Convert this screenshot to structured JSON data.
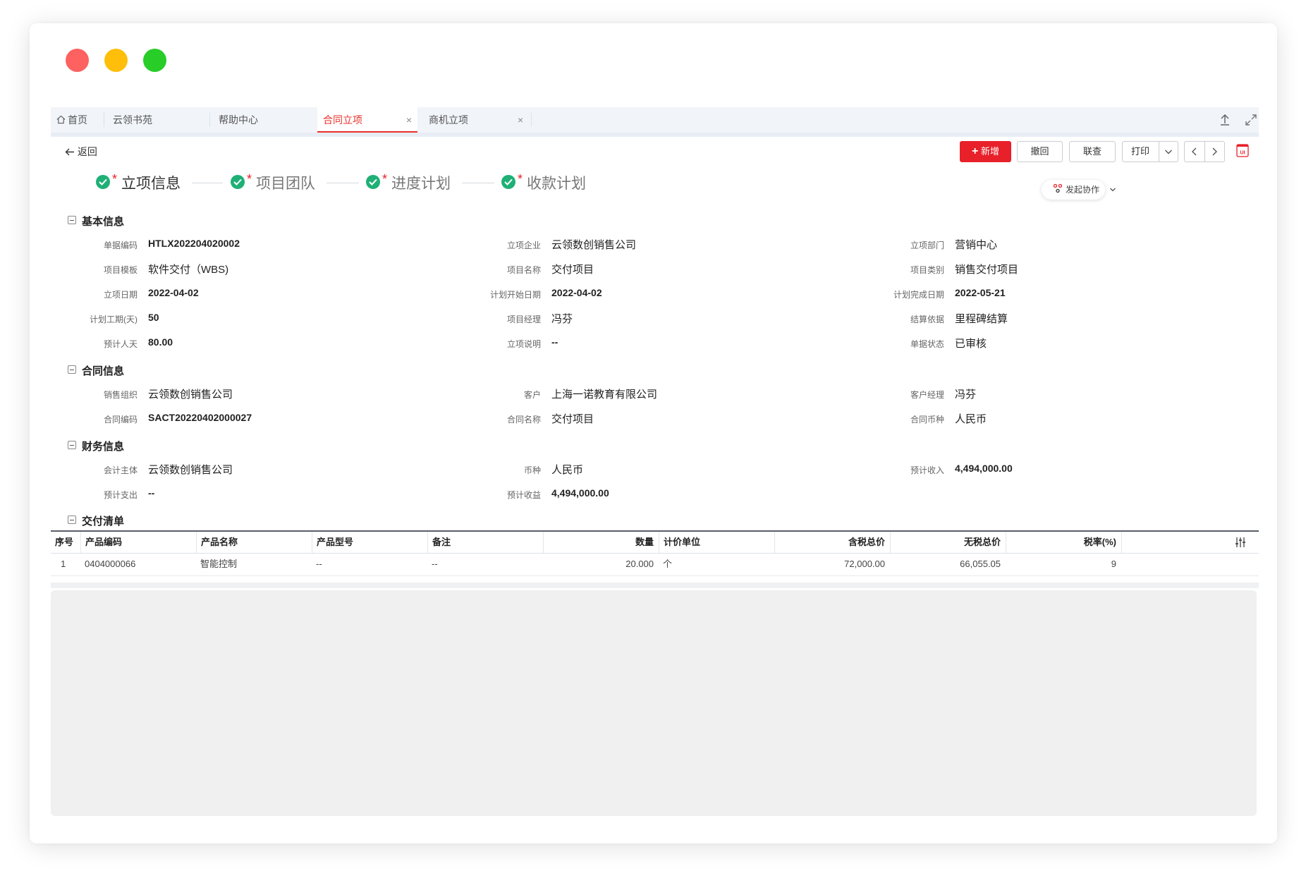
{
  "tabs": [
    {
      "label": "首页",
      "icon": "home-icon"
    },
    {
      "label": "云领书苑"
    },
    {
      "label": "帮助中心"
    },
    {
      "label": "合同立项",
      "active": true,
      "closable": true
    },
    {
      "label": "商机立项",
      "closable": true
    }
  ],
  "tab_close": "×",
  "toolbar": {
    "back": "返回",
    "new_label": "新增",
    "withdraw_label": "撤回",
    "link_query_label": "联查",
    "print_label": "打印"
  },
  "steps": [
    {
      "label": "立项信息"
    },
    {
      "label": "项目团队"
    },
    {
      "label": "进度计划"
    },
    {
      "label": "收款计划"
    }
  ],
  "required_mark": "*",
  "collab_label": "发起协作",
  "sections": {
    "basic": "基本信息",
    "contract": "合同信息",
    "finance": "财务信息",
    "delivery": "交付清单"
  },
  "basic": {
    "doc_no_label": "单据编码",
    "doc_no": "HTLX202204020002",
    "company_label": "立项企业",
    "company": "云领数创销售公司",
    "dept_label": "立项部门",
    "dept": "营销中心",
    "template_label": "项目模板",
    "template": "软件交付（WBS)",
    "project_name_label": "项目名称",
    "project_name": "交付项目",
    "category_label": "项目类别",
    "category": "销售交付项目",
    "date_label": "立项日期",
    "date": "2022-04-02",
    "plan_start_label": "计划开始日期",
    "plan_start": "2022-04-02",
    "plan_end_label": "计划完成日期",
    "plan_end": "2022-05-21",
    "duration_label": "计划工期(天)",
    "duration": "50",
    "pm_label": "项目经理",
    "pm": "冯芬",
    "settle_label": "结算依据",
    "settle": "里程碑结算",
    "man_days_label": "预计人天",
    "man_days": "80.00",
    "desc_label": "立项说明",
    "desc": "--",
    "status_label": "单据状态",
    "status": "已审核"
  },
  "contract": {
    "sales_org_label": "销售组织",
    "sales_org": "云领数创销售公司",
    "customer_label": "客户",
    "customer": "上海一诺教育有限公司",
    "cust_mgr_label": "客户经理",
    "cust_mgr": "冯芬",
    "contract_no_label": "合同编码",
    "contract_no": "SACT20220402000027",
    "contract_name_label": "合同名称",
    "contract_name": "交付项目",
    "currency_label": "合同币种",
    "currency": "人民币"
  },
  "finance": {
    "entity_label": "会计主体",
    "entity": "云领数创销售公司",
    "currency_label": "币种",
    "currency": "人民币",
    "income_label": "预计收入",
    "income": "4,494,000.00",
    "expense_label": "预计支出",
    "expense": "--",
    "profit_label": "预计收益",
    "profit": "4,494,000.00"
  },
  "table": {
    "headers": [
      "序号",
      "产品编码",
      "产品名称",
      "产品型号",
      "备注",
      "数量",
      "计价单位",
      "含税总价",
      "无税总价",
      "税率(%)"
    ],
    "rows": [
      [
        "1",
        "0404000066",
        "智能控制",
        "--",
        "--",
        "20.000",
        "个",
        "72,000.00",
        "66,055.05",
        "9"
      ]
    ]
  }
}
